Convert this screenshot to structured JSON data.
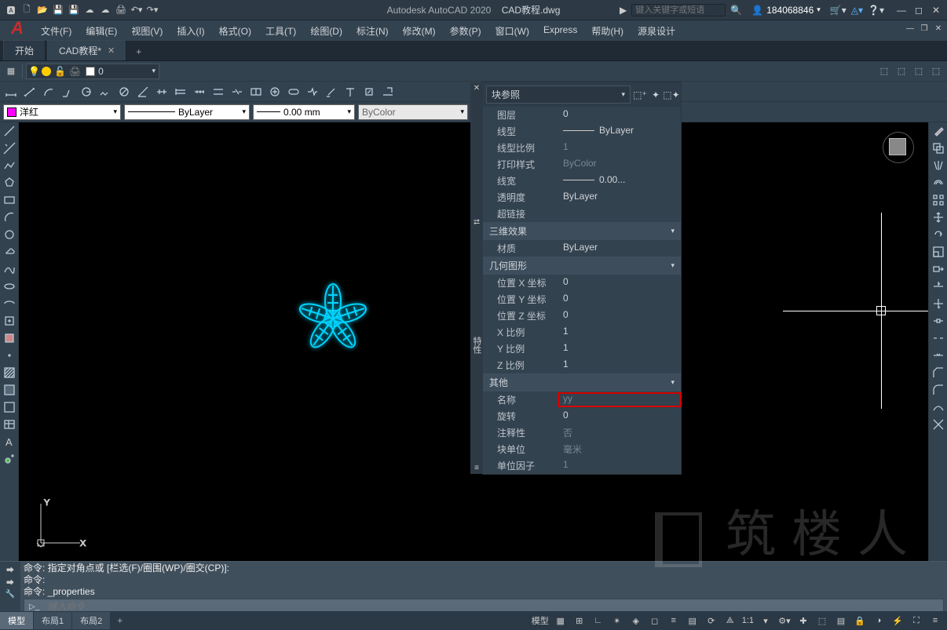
{
  "app": {
    "name": "Autodesk AutoCAD 2020",
    "doc": "CAD教程.dwg"
  },
  "search": {
    "placeholder": "键入关键字或短语"
  },
  "account": {
    "id": "184068846"
  },
  "menus": [
    "文件(F)",
    "编辑(E)",
    "视图(V)",
    "插入(I)",
    "格式(O)",
    "工具(T)",
    "绘图(D)",
    "标注(N)",
    "修改(M)",
    "参数(P)",
    "窗口(W)",
    "Express",
    "帮助(H)",
    "源泉设计"
  ],
  "tabs": {
    "start": "开始",
    "active": "CAD教程*"
  },
  "layer": {
    "current": "0"
  },
  "props_bar": {
    "color": "洋红",
    "linetype": "ByLayer",
    "lineweight": "0.00 mm",
    "plotstyle": "ByColor"
  },
  "properties": {
    "title": "特性",
    "type": "块参照",
    "general": {
      "layer_label": "图层",
      "layer": "0",
      "linetype_label": "线型",
      "linetype": "ByLayer",
      "ltscale_label": "线型比例",
      "ltscale": "1",
      "plotstyle_label": "打印样式",
      "plotstyle": "ByColor",
      "lineweight_label": "线宽",
      "lineweight": "0.00...",
      "transparency_label": "透明度",
      "transparency": "ByLayer",
      "hyperlink_label": "超链接"
    },
    "section_3d": "三维效果",
    "material_label": "材质",
    "material": "ByLayer",
    "section_geom": "几何图形",
    "geom": {
      "posx_label": "位置 X 坐标",
      "posx": "0",
      "posy_label": "位置 Y 坐标",
      "posy": "0",
      "posz_label": "位置 Z 坐标",
      "posz": "0",
      "scalex_label": "X 比例",
      "scalex": "1",
      "scaley_label": "Y 比例",
      "scaley": "1",
      "scalez_label": "Z 比例",
      "scalez": "1"
    },
    "section_misc": "其他",
    "misc": {
      "name_label": "名称",
      "name": "yy",
      "rotation_label": "旋转",
      "rotation": "0",
      "annotative_label": "注释性",
      "annotative": "否",
      "blockunit_label": "块单位",
      "blockunit": "毫米",
      "unitfactor_label": "单位因子",
      "unitfactor": "1"
    }
  },
  "command": {
    "line1_prefix": "命令: ",
    "line1": "指定对角点或 [栏选(F)/圈围(WP)/圈交(CP)]:",
    "line2": "命令:",
    "line3_prefix": "命令: ",
    "line3": "_properties",
    "input_placeholder": "键入命令"
  },
  "bottom_tabs": {
    "model": "模型",
    "layout1": "布局1",
    "layout2": "布局2"
  },
  "status": {
    "model": "模型",
    "scale": "1:1"
  },
  "watermark": "筑楼人"
}
